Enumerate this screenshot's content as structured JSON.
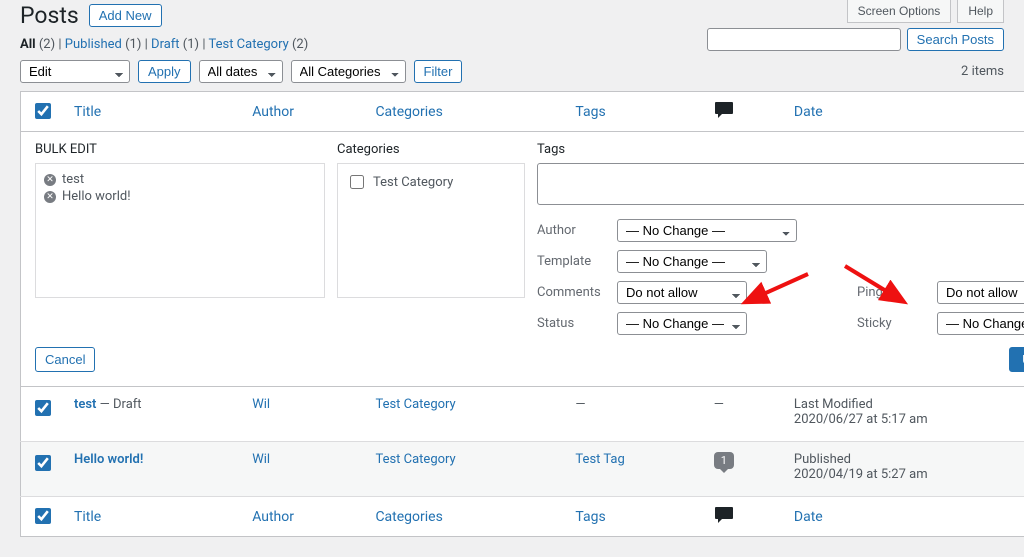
{
  "screen_tabs": {
    "options": "Screen Options",
    "help": "Help"
  },
  "page": {
    "title": "Posts",
    "add_new": "Add New"
  },
  "filters": {
    "all": "All",
    "all_count": "(2)",
    "published": "Published",
    "published_count": "(1)",
    "draft": "Draft",
    "draft_count": "(1)",
    "test_cat": "Test Category",
    "test_cat_count": "(2)"
  },
  "search": {
    "button": "Search Posts"
  },
  "tablenav": {
    "bulk_action": "Edit",
    "apply": "Apply",
    "date_filter": "All dates",
    "cat_filter": "All Categories",
    "filter": "Filter",
    "items": "2 items"
  },
  "columns": {
    "title": "Title",
    "author": "Author",
    "categories": "Categories",
    "tags": "Tags",
    "date": "Date"
  },
  "bulk_edit": {
    "heading": "BULK EDIT",
    "items": [
      "test",
      "Hello world!"
    ],
    "cat_heading": "Categories",
    "cat_items": [
      "Test Category"
    ],
    "tags_heading": "Tags",
    "labels": {
      "author": "Author",
      "template": "Template",
      "comments": "Comments",
      "status": "Status",
      "pings": "Pings",
      "sticky": "Sticky"
    },
    "no_change": "— No Change —",
    "do_not_allow": "Do not allow",
    "cancel": "Cancel",
    "update": "Update"
  },
  "rows": [
    {
      "title": "test",
      "status": " — Draft",
      "author": "Wil",
      "category": "Test Category",
      "tags": "—",
      "comments": "—",
      "date_label": "Last Modified",
      "date": "2020/06/27 at 5:17 am"
    },
    {
      "title": "Hello world!",
      "status": "",
      "author": "Wil",
      "category": "Test Category",
      "tags": "Test Tag",
      "comments": "1",
      "date_label": "Published",
      "date": "2020/04/19 at 5:27 am"
    }
  ]
}
